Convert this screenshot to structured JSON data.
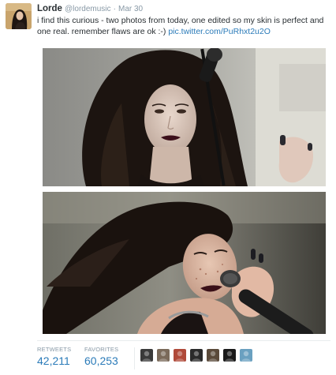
{
  "tweet": {
    "author_name": "Lorde",
    "author_handle": "@lordemusic",
    "separator": "·",
    "date": "Mar 30",
    "text": "i find this curious - two photos from today, one edited so my skin is perfect and one real. remember flaws are ok :-)",
    "link": "pic.twitter.com/PuRhxt2u2O"
  },
  "stats": {
    "retweets_label": "RETWEETS",
    "retweets_count": "42,211",
    "favorites_label": "FAVORITES",
    "favorites_count": "60,253"
  },
  "favoriters": [
    {
      "color": "#3a3a3a"
    },
    {
      "color": "#7a6a5a"
    },
    {
      "color": "#b04a3a"
    },
    {
      "color": "#2a2a2a"
    },
    {
      "color": "#5a4a3a"
    },
    {
      "color": "#1a1a1a"
    },
    {
      "color": "#6aa0c0"
    }
  ]
}
